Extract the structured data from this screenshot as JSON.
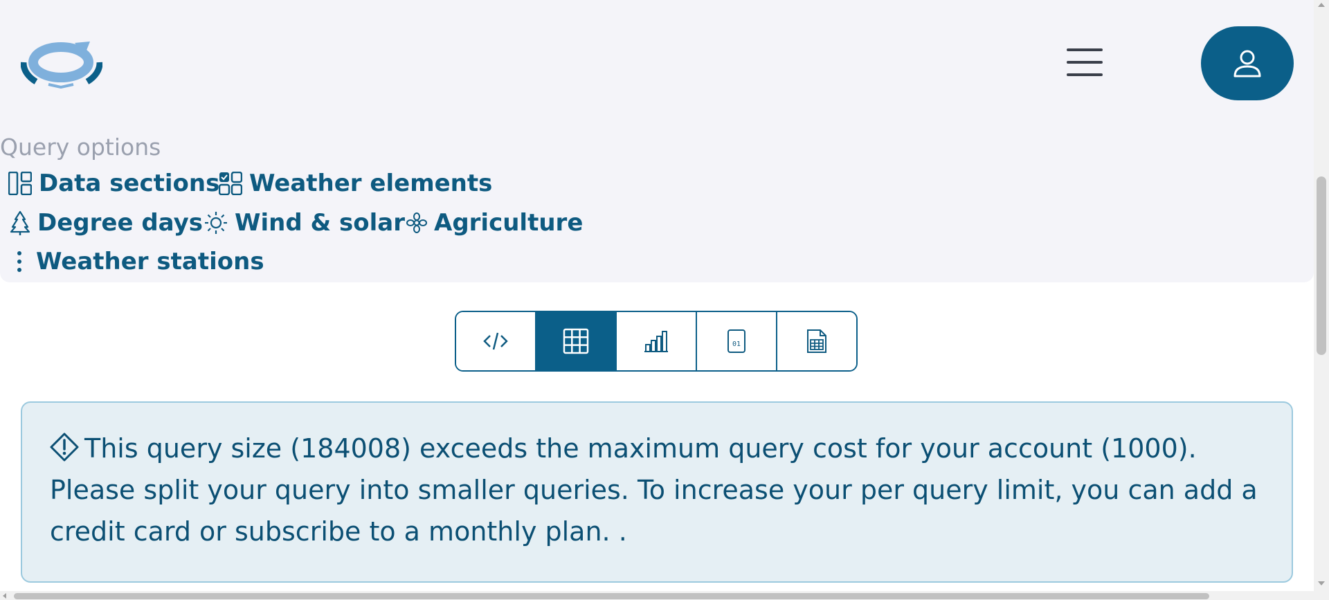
{
  "header": {
    "logo_icon": "refresh-cycle-logo",
    "menu_icon": "hamburger-icon",
    "user_icon": "user-icon"
  },
  "query_options": {
    "title": "Query options",
    "links": [
      {
        "label": "Data sections",
        "icon": "layout-icon"
      },
      {
        "label": "Weather elements",
        "icon": "checkbox-grid-icon"
      },
      {
        "label": "Degree days",
        "icon": "tree-icon"
      },
      {
        "label": "Wind & solar",
        "icon": "sun-icon"
      },
      {
        "label": "Agriculture",
        "icon": "flower-icon"
      },
      {
        "label": "Weather stations",
        "icon": "vertical-dots-icon"
      }
    ]
  },
  "toolbar": {
    "buttons": [
      {
        "icon": "code-icon",
        "active": false
      },
      {
        "icon": "table-grid-icon",
        "active": true
      },
      {
        "icon": "bar-chart-icon",
        "active": false
      },
      {
        "icon": "binary-file-icon",
        "active": false
      },
      {
        "icon": "spreadsheet-file-icon",
        "active": false
      }
    ]
  },
  "alert": {
    "icon": "warning-diamond-icon",
    "message": "This query size (184008) exceeds the maximum query cost for your account (1000). Please split your query into smaller queries. To increase your per query limit, you can add a credit card or subscribe to a monthly plan. ."
  },
  "colors": {
    "brand": "#0b5f89",
    "panel_bg": "#f4f4f9",
    "alert_bg": "#e5eff4",
    "alert_border": "#9bc9de",
    "muted_text": "#9aa0ae"
  }
}
